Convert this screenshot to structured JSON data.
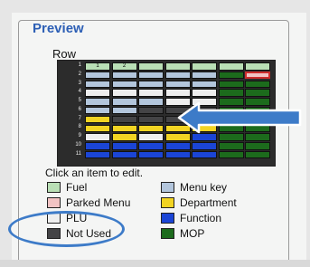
{
  "panel": {
    "title": "Preview",
    "row_label": "Row",
    "click_text": "Click an item to edit."
  },
  "grid": {
    "row_numbers": [
      "1",
      "2",
      "3",
      "4",
      "5",
      "6",
      "7",
      "8",
      "9",
      "10",
      "11"
    ],
    "header_labels": [
      "1",
      "2"
    ],
    "rows": [
      [
        "fuel",
        "fuel",
        "fuel",
        "fuel",
        "fuel",
        "fuel",
        "fuel"
      ],
      [
        "menu",
        "menu",
        "menu",
        "menu",
        "menu",
        "mop",
        "parked"
      ],
      [
        "menu",
        "menu",
        "menu",
        "menu",
        "menu",
        "mop",
        "mop"
      ],
      [
        "plu",
        "plu",
        "plu",
        "plu",
        "plu",
        "mop",
        "mop"
      ],
      [
        "menu",
        "menu",
        "menu",
        "plu",
        "plu",
        "mop",
        "mop"
      ],
      [
        "menu",
        "menu",
        "unused",
        "unused",
        "unused",
        "mop",
        "mop"
      ],
      [
        "dept",
        "unused",
        "unused",
        "unused",
        "unused",
        "mop",
        "mop"
      ],
      [
        "dept",
        "dept",
        "dept",
        "dept",
        "dept",
        "mop",
        "mop"
      ],
      [
        "plu",
        "dept",
        "plu",
        "dept",
        "func",
        "mop",
        "mop"
      ],
      [
        "func",
        "func",
        "func",
        "func",
        "func",
        "mop",
        "mop"
      ],
      [
        "func",
        "func",
        "func",
        "func",
        "func",
        "mop",
        "mop"
      ]
    ],
    "selected": [
      1,
      6
    ]
  },
  "legend": {
    "fuel": "Fuel",
    "menu": "Menu key",
    "parked": "Parked Menu",
    "dept": "Department",
    "plu": "PLU",
    "func": "Function",
    "unused": "Not Used",
    "mop": "MOP"
  },
  "colors": {
    "fuel": "#b9dfb5",
    "parked": "#f1c3c3",
    "plu": "#eeeeee",
    "unused": "#444446",
    "menu": "#b3c6dc",
    "dept": "#f2d423",
    "func": "#1b45d5",
    "mop": "#1c6b1c",
    "annotation": "#3d7bc8",
    "title": "#2d5fb5"
  },
  "annotations": {
    "arrow_icon": "left-arrow-icon",
    "highlight": "oval-highlight"
  }
}
